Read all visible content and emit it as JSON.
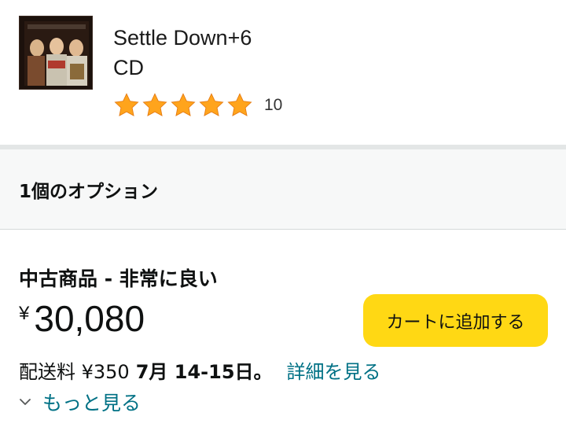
{
  "product": {
    "title": "Settle Down+6",
    "format": "CD",
    "rating": {
      "stars": 5,
      "max": 5,
      "count": "10"
    },
    "icons": {
      "art": "album-cover-image",
      "star": "star-icon"
    },
    "colors": {
      "star": "#ffa41c"
    }
  },
  "options": {
    "label": "1個のオプション"
  },
  "offer": {
    "condition": "中古商品 - 非常に良い",
    "currency": "¥",
    "price": "30,080",
    "add_to_cart_label": "カートに追加する",
    "shipping_fee": "配送料 ¥350",
    "delivery_date": "7月 14-15日。",
    "details_link": "詳細を見る",
    "see_more": "もっと見る",
    "colors": {
      "button": "#ffd814",
      "link": "#007185"
    }
  }
}
